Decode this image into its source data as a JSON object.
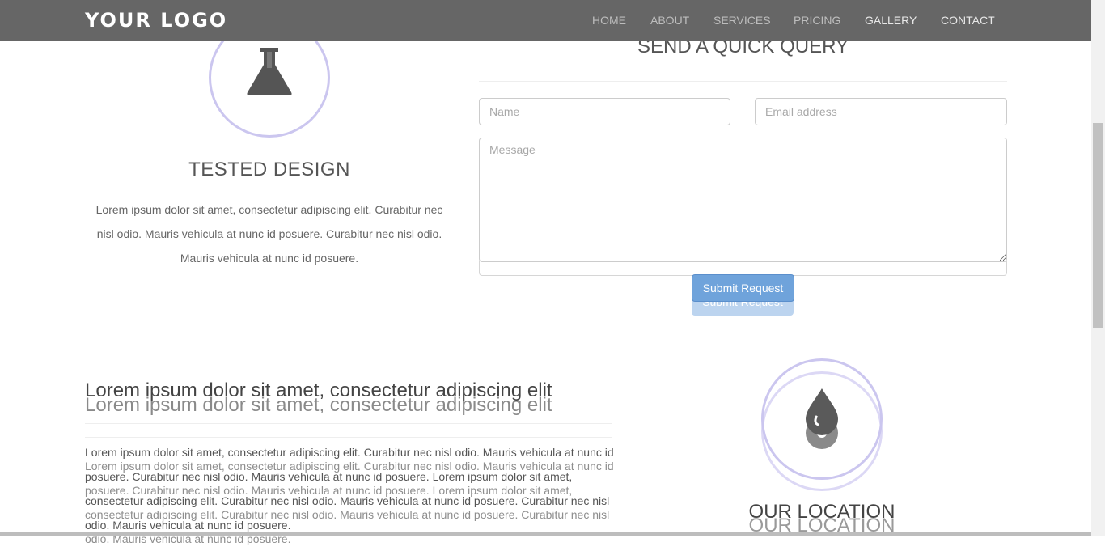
{
  "nav": {
    "logo": "YOUR LOGO",
    "links": [
      "HOME",
      "ABOUT",
      "SERVICES",
      "PRICING",
      "GALLERY",
      "CONTACT"
    ]
  },
  "feature": {
    "icon": "flask-icon",
    "title": "TESTED DESIGN",
    "text": "Lorem ipsum dolor sit amet, consectetur adipiscing elit. Curabitur nec nisl odio. Mauris vehicula at nunc id posuere. Curabitur nec nisl odio. Mauris vehicula at nunc id posuere."
  },
  "query_form": {
    "title": "SEND A QUICK QUERY",
    "name_placeholder": "Name",
    "email_placeholder": "Email address",
    "message_placeholder": "Message",
    "submit_label": "Submit Request"
  },
  "about": {
    "heading": "Lorem ipsum dolor sit amet, consectetur adipiscing elit",
    "text": "Lorem ipsum dolor sit amet, consectetur adipiscing elit. Curabitur nec nisl odio. Mauris vehicula at nunc id posuere. Curabitur nec nisl odio. Mauris vehicula at nunc id posuere. Lorem ipsum dolor sit amet, consectetur adipiscing elit. Curabitur nec nisl odio. Mauris vehicula at nunc id posuere. Curabitur nec nisl odio. Mauris vehicula at nunc id posuere."
  },
  "location": {
    "icon": "water-drop-icon",
    "title": "OUR LOCATION"
  },
  "colors": {
    "navbar": "#666666",
    "icon_ring": "#cbc6ef",
    "button": "#6fa3db"
  }
}
